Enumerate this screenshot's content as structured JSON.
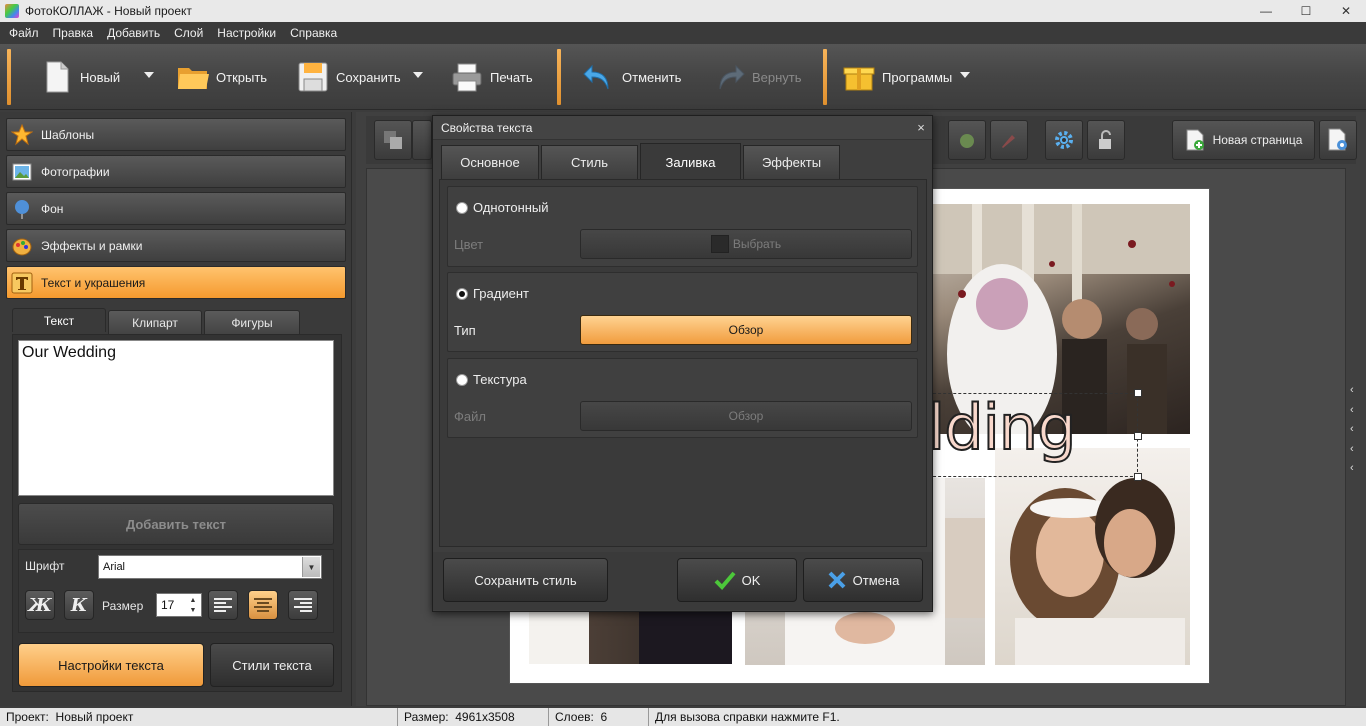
{
  "window": {
    "title": "ФотоКОЛЛАЖ - Новый проект",
    "min": "—",
    "max": "☐",
    "close": "✕"
  },
  "menu": [
    "Файл",
    "Правка",
    "Добавить",
    "Слой",
    "Настройки",
    "Справка"
  ],
  "toolbar": {
    "new": "Новый",
    "open": "Открыть",
    "save": "Сохранить",
    "print": "Печать",
    "undo": "Отменить",
    "redo": "Вернуть",
    "programs": "Программы"
  },
  "sidebar": {
    "sections": [
      "Шаблоны",
      "Фотографии",
      "Фон",
      "Эффекты и рамки",
      "Текст и украшения"
    ],
    "active_section": "Текст и украшения",
    "tabs": [
      "Текст",
      "Клипарт",
      "Фигуры"
    ],
    "text_value": "Our Wedding",
    "add_text": "Добавить текст",
    "font_label": "Шрифт",
    "font_value": "Arial",
    "bold_glyph": "Ж",
    "italic_glyph": "К",
    "size_label": "Размер",
    "size_value": "17",
    "settings_button": "Настройки текста",
    "styles_button": "Стили текста"
  },
  "worktoolbar": {
    "new_page": "Новая страница"
  },
  "canvas": {
    "overlay_text": "lding"
  },
  "dialog": {
    "title": "Свойства текста",
    "close": "×",
    "tabs": [
      "Основное",
      "Стиль",
      "Заливка",
      "Эффекты"
    ],
    "active_tab": "Заливка",
    "solid": {
      "label": "Однотонный",
      "field": "Цвет",
      "button": "Выбрать",
      "checked": false
    },
    "gradient": {
      "label": "Градиент",
      "field": "Тип",
      "button": "Обзор",
      "checked": true
    },
    "texture": {
      "label": "Текстура",
      "field": "Файл",
      "button": "Обзор",
      "checked": false
    },
    "save_style": "Сохранить стиль",
    "ok": "OK",
    "cancel": "Отмена"
  },
  "status": {
    "project_label": "Проект:",
    "project_value": "Новый проект",
    "size_label": "Размер:",
    "size_value": "4961x3508",
    "layers_label": "Слоев:",
    "layers_value": "6",
    "help": "Для вызова справки нажмите F1."
  },
  "colors": {
    "accent": "#f5a040",
    "background": "#3c3c3c"
  }
}
